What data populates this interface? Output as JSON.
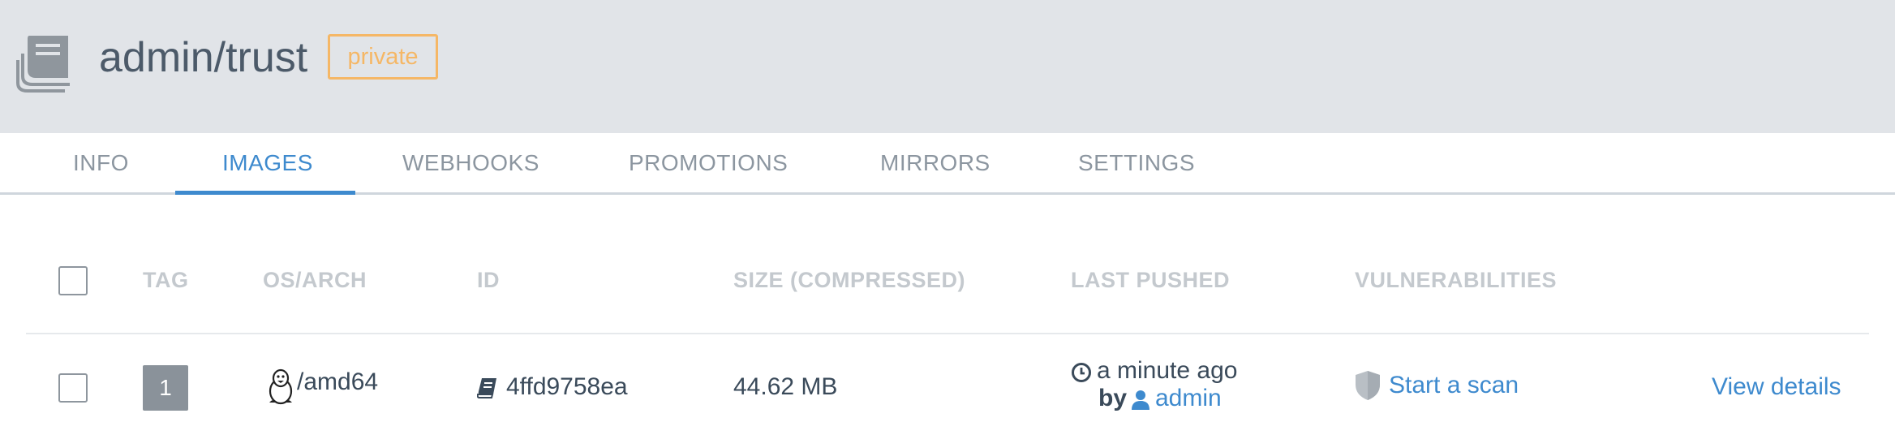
{
  "header": {
    "repo_title": "admin/trust",
    "visibility_badge": "private",
    "repo_icon": "book-stack-icon"
  },
  "tabs": [
    {
      "label": "INFO",
      "active": false
    },
    {
      "label": "IMAGES",
      "active": true
    },
    {
      "label": "WEBHOOKS",
      "active": false
    },
    {
      "label": "PROMOTIONS",
      "active": false
    },
    {
      "label": "MIRRORS",
      "active": false
    },
    {
      "label": "SETTINGS",
      "active": false
    }
  ],
  "table": {
    "columns": [
      "TAG",
      "OS/ARCH",
      "ID",
      "SIZE (COMPRESSED)",
      "LAST PUSHED",
      "VULNERABILITIES"
    ],
    "rows": [
      {
        "tag": "1",
        "os_icon": "linux-penguin-icon",
        "arch": "/amd64",
        "id_icon": "book-icon",
        "id": "4ffd9758ea",
        "size": "44.62 MB",
        "pushed_icon": "clock-icon",
        "pushed_time": "a minute ago",
        "pushed_by_prefix": "by",
        "user_icon": "user-icon",
        "pushed_by": "admin",
        "vuln_icon": "shield-icon",
        "vuln_action": "Start a scan",
        "details_link": "View details"
      }
    ]
  },
  "colors": {
    "accent": "#3e8ace",
    "badge": "#f5b766",
    "header_bg": "#e1e4e8"
  }
}
